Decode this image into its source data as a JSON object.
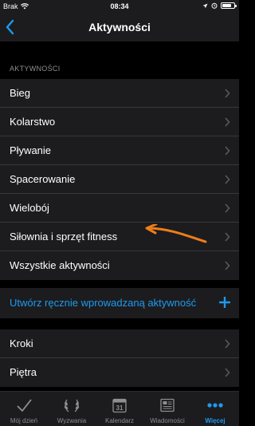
{
  "status_bar": {
    "carrier": "Brak",
    "time": "08:34",
    "battery_level": 0.8
  },
  "nav": {
    "title": "Aktywności",
    "back_icon": "chevron-left-icon"
  },
  "section": {
    "label": "AKTYWNOŚCI"
  },
  "activities": [
    {
      "label": "Bieg"
    },
    {
      "label": "Kolarstwo"
    },
    {
      "label": "Pływanie"
    },
    {
      "label": "Spacerowanie"
    },
    {
      "label": "Wielobój"
    },
    {
      "label": "Siłownia i sprzęt fitness"
    },
    {
      "label": "Wszystkie aktywności"
    }
  ],
  "add_manual": {
    "label": "Utwórz ręcznie wprowadzaną aktywność",
    "icon": "plus-icon"
  },
  "other": [
    {
      "label": "Kroki"
    },
    {
      "label": "Piętra"
    }
  ],
  "tabs": [
    {
      "label": "Mój dzień",
      "icon": "checkmark-icon",
      "active": false
    },
    {
      "label": "Wyzwania",
      "icon": "laurel-icon",
      "active": false
    },
    {
      "label": "Kalendarz",
      "icon": "calendar-icon",
      "calendar_day": "31",
      "active": false
    },
    {
      "label": "Wiadomości",
      "icon": "newspaper-icon",
      "active": false
    },
    {
      "label": "Więcej",
      "icon": "more-dots-icon",
      "active": true
    }
  ],
  "colors": {
    "accent": "#1c9bf0",
    "annotation_arrow": "#f07d1a",
    "row_bg": "#1c1c1e"
  }
}
